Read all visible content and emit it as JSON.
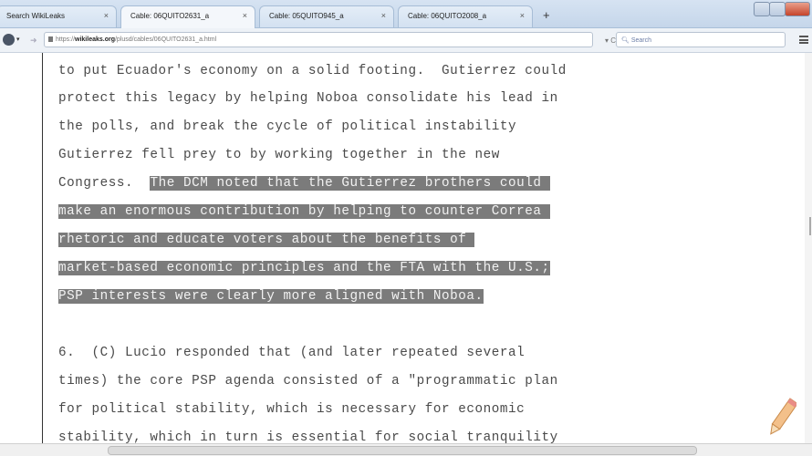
{
  "tabs": [
    {
      "label": "Search WikiLeaks",
      "active": false
    },
    {
      "label": "Cable: 06QUITO2631_a",
      "active": true
    },
    {
      "label": "Cable: 05QUITO945_a",
      "active": false
    },
    {
      "label": "Cable: 06QUITO2008_a",
      "active": false
    }
  ],
  "tab_close_glyph": "×",
  "new_tab_glyph": "+",
  "url": {
    "prefix": "https://",
    "domain": "wikileaks.org",
    "path": "/plusd/cables/06QUITO2631_a.html"
  },
  "search": {
    "placeholder": "Search"
  },
  "document": {
    "lines": [
      {
        "text": "to put Ecuador's economy on a solid footing.  Gutierrez could",
        "highlighted": false
      },
      {
        "text": "protect this legacy by helping Noboa consolidate his lead in",
        "highlighted": false
      },
      {
        "text": "the polls, and break the cycle of political instability",
        "highlighted": false
      },
      {
        "text": "Gutierrez fell prey to by working together in the new",
        "highlighted": false
      },
      {
        "pre": "Congress.  ",
        "text": "The DCM noted that the Gutierrez brothers could ",
        "highlighted": true
      },
      {
        "text": "make an enormous contribution by helping to counter Correa ",
        "highlighted": true
      },
      {
        "text": "rhetoric and educate voters about the benefits of ",
        "highlighted": true
      },
      {
        "text": "market-based economic principles and the FTA with the U.S.;",
        "highlighted": true
      },
      {
        "text": "PSP interests were clearly more aligned with Noboa.",
        "highlighted": true
      },
      {
        "text": "",
        "highlighted": false
      },
      {
        "text": "6.  (C) Lucio responded that (and later repeated several",
        "highlighted": false
      },
      {
        "text": "times) the core PSP agenda consisted of a \"programmatic plan",
        "highlighted": false
      },
      {
        "text": "for political stability, which is necessary for economic",
        "highlighted": false
      },
      {
        "text": "stability, which in turn is essential for social tranquility",
        "highlighted": false
      }
    ]
  },
  "icons": {
    "back": "back-arrow-icon",
    "forward": "forward-arrow-icon",
    "reload": "reload-icon",
    "search": "search-icon",
    "menu": "hamburger-menu-icon",
    "pencil": "pencil-icon"
  },
  "colors": {
    "highlight": "#7b7b7b",
    "text": "#4a4a4a"
  }
}
